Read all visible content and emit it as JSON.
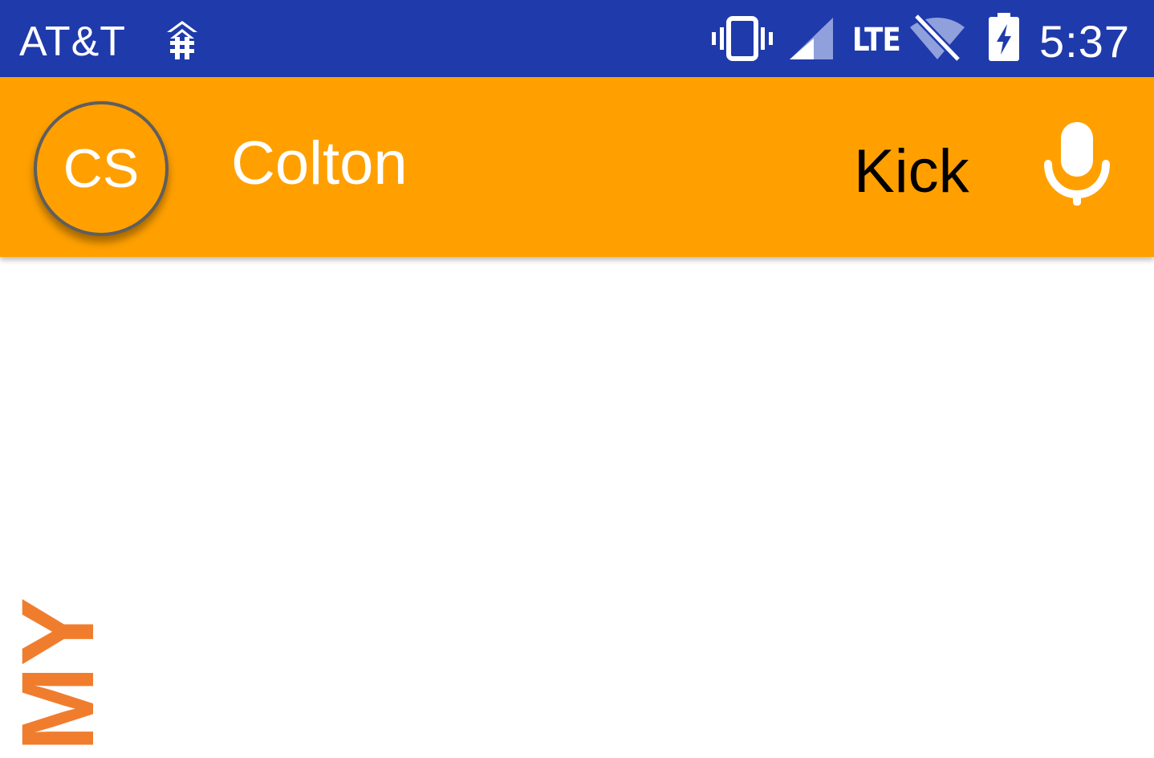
{
  "status_bar": {
    "carrier": "AT&T",
    "network_type": "LTE",
    "time": "5:37",
    "background": "#1f3aab",
    "icons": [
      "network-tree-icon",
      "vibrate-icon",
      "cell-signal-icon",
      "wifi-off-icon",
      "battery-charging-icon"
    ]
  },
  "app_bar": {
    "background": "#ffa000",
    "avatar_initials": "CS",
    "user_name": "Colton",
    "kick_label": "Kick",
    "mic_icon": "microphone-icon"
  },
  "logo": {
    "text": "MY",
    "color": "#f07d2e"
  }
}
